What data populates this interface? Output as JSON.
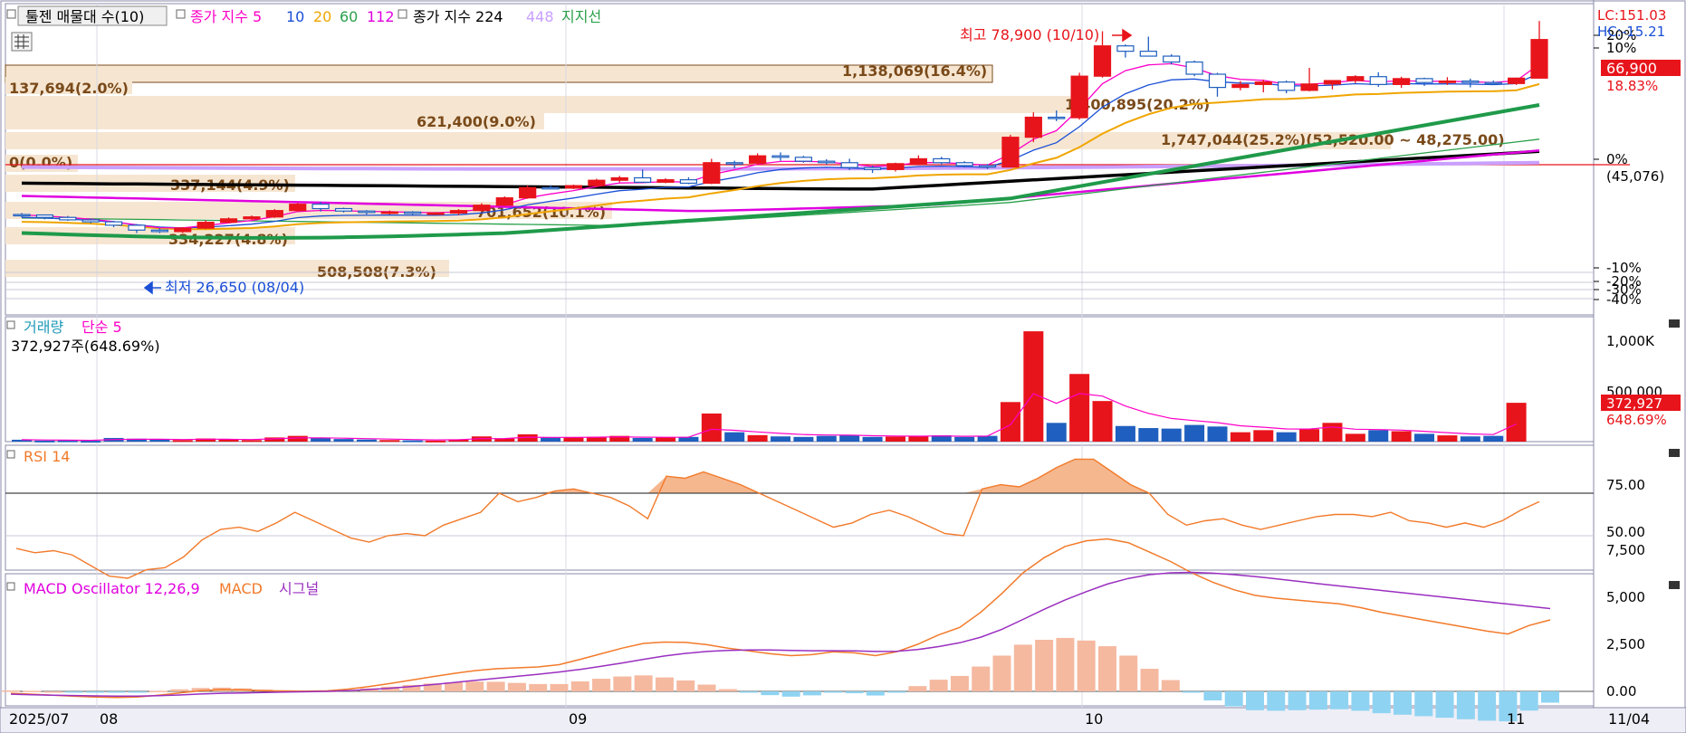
{
  "colors": {
    "up": "#e8141b",
    "down": "#1f5fbf",
    "ma5": "#ff00c8",
    "ma10": "#1a4fd6",
    "ma20": "#f0a500",
    "ma60": "#2aa04a",
    "ma112": "#e000e0",
    "ma224": "#000000",
    "ma448": "#c9a0ff",
    "support": "#1f9a4a",
    "band": "#f6e6d1",
    "bandText": "#7a4a1a",
    "rsi": "#f27a2a",
    "rsiFill": "#f5b78e",
    "macd": "#f27a2a",
    "signal": "#9a2fc0",
    "oscPos": "#f5b9a0",
    "oscNeg": "#8fd3f2",
    "redline": "#e8141b",
    "grid": "#d8d8e4"
  },
  "header": {
    "vp_button": "툴젠 매물대 수(10)",
    "ma_label": "종가 지수 5",
    "ma10": "10",
    "ma20": "20",
    "ma60": "60",
    "ma112": "112",
    "ma_label2": "종가 지수 224",
    "ma448": "448",
    "support": "지지선",
    "lc": "LC:151.03",
    "hc": "HC:-15.21"
  },
  "annotations": {
    "high": "최고 78,900 (10/10)",
    "low": "최저 26,650 (08/04)"
  },
  "right_axis": {
    "price_ticks": [
      "20%",
      "10%",
      "0%",
      "(45,076)",
      "-10%",
      "-20%",
      "-30%",
      "-40%"
    ],
    "current_price": "66,900",
    "current_pct": "18.83%",
    "volume_ticks": [
      "1,000K",
      "500,000"
    ],
    "volume_current": "372,927",
    "volume_pct": "648.69%",
    "rsi_ticks": [
      "75.00",
      "50.00"
    ],
    "macd_ticks": [
      "7,500",
      "5,000",
      "2,500",
      "0.00"
    ],
    "x_end": "11/04"
  },
  "x_labels": [
    "2025/07",
    "08",
    "09",
    "10",
    "11"
  ],
  "panels": {
    "volume_title": "거래량",
    "volume_ma": "단순 5",
    "volume_value": "372,927주(648.69%)",
    "rsi_title": "RSI 14",
    "macd_title": "MACD Oscillator 12,26,9",
    "macd_label": "MACD",
    "signal_label": "시그널"
  },
  "chart_data": {
    "type": "candlestick",
    "date_range": [
      "2025/07",
      "11/04"
    ],
    "volume_profile": [
      {
        "label": "1,138,069(16.4%)"
      },
      {
        "label": "137,694(2.0%)"
      },
      {
        "label": "1,400,895(20.2%)"
      },
      {
        "label": "621,400(9.0%)"
      },
      {
        "label": "1,747,044(25.2%)(52,520.00 ~ 48,275.00)"
      },
      {
        "label": "0(0.0%)"
      },
      {
        "label": "337,144(4.9%)"
      },
      {
        "label": "701,652(10.1%)"
      },
      {
        "label": "334,227(4.8%)"
      },
      {
        "label": "508,508(7.3%)"
      }
    ],
    "volume_profile_pct": [
      16.4,
      2.0,
      20.2,
      9.0,
      25.2,
      0.0,
      4.9,
      10.1,
      4.8,
      7.3
    ],
    "candles_pct": [
      [
        -10.0,
        -9.7,
        -10.6,
        -10.1
      ],
      [
        -10.1,
        -10.0,
        -11.0,
        -10.6
      ],
      [
        -10.6,
        -10.3,
        -11.3,
        -11.1
      ],
      [
        -11.1,
        -10.9,
        -11.8,
        -11.5
      ],
      [
        -11.5,
        -11.3,
        -12.6,
        -12.2
      ],
      [
        -12.2,
        -12.0,
        -13.8,
        -13.2
      ],
      [
        -13.2,
        -12.8,
        -13.8,
        -13.5
      ],
      [
        -13.5,
        -12.6,
        -13.8,
        -12.8
      ],
      [
        -12.8,
        -11.2,
        -13.0,
        -11.6
      ],
      [
        -11.6,
        -10.6,
        -11.8,
        -10.9
      ],
      [
        -10.9,
        -10.2,
        -11.1,
        -10.5
      ],
      [
        -10.5,
        -8.9,
        -10.7,
        -9.2
      ],
      [
        -9.2,
        -7.6,
        -9.4,
        -7.9
      ],
      [
        -7.9,
        -7.4,
        -9.4,
        -8.8
      ],
      [
        -8.8,
        -8.6,
        -9.6,
        -9.3
      ],
      [
        -9.3,
        -9.1,
        -10.0,
        -9.6
      ],
      [
        -9.6,
        -9.2,
        -10.0,
        -9.5
      ],
      [
        -9.5,
        -9.3,
        -10.2,
        -9.8
      ],
      [
        -9.8,
        -9.5,
        -10.1,
        -9.7
      ],
      [
        -9.7,
        -8.9,
        -10.1,
        -9.2
      ],
      [
        -9.2,
        -7.7,
        -9.4,
        -8.1
      ],
      [
        -8.1,
        -6.3,
        -8.3,
        -6.6
      ],
      [
        -6.6,
        -4.1,
        -6.8,
        -4.5
      ],
      [
        -4.5,
        -4.0,
        -4.8,
        -4.6
      ],
      [
        -4.6,
        -3.9,
        -4.8,
        -4.1
      ],
      [
        -4.1,
        -2.7,
        -4.4,
        -3.0
      ],
      [
        -3.0,
        -2.1,
        -3.4,
        -2.5
      ],
      [
        -2.5,
        -0.8,
        -3.5,
        -3.4
      ],
      [
        -3.4,
        -2.6,
        -3.6,
        -2.9
      ],
      [
        -2.9,
        -2.4,
        -3.8,
        -3.6
      ],
      [
        -3.6,
        1.4,
        -3.8,
        0.6
      ],
      [
        0.6,
        1.0,
        -0.6,
        0.5
      ],
      [
        0.5,
        2.5,
        0.2,
        2.0
      ],
      [
        2.0,
        2.7,
        1.0,
        1.7
      ],
      [
        1.7,
        2.0,
        0.6,
        0.9
      ],
      [
        0.9,
        1.3,
        0.2,
        0.6
      ],
      [
        0.6,
        1.4,
        -0.9,
        -0.4
      ],
      [
        -0.4,
        0.0,
        -1.5,
        -0.8
      ],
      [
        -0.8,
        0.6,
        -1.2,
        0.4
      ],
      [
        0.4,
        2.1,
        0.2,
        1.4
      ],
      [
        1.4,
        1.8,
        0.2,
        0.6
      ],
      [
        0.6,
        0.9,
        -0.4,
        0.0
      ],
      [
        0.0,
        0.3,
        -0.7,
        -0.3
      ],
      [
        -0.3,
        6.3,
        -0.4,
        5.8
      ],
      [
        5.8,
        10.9,
        4.8,
        9.9
      ],
      [
        9.9,
        11.3,
        9.1,
        9.8
      ],
      [
        9.8,
        19.0,
        9.4,
        18.3
      ],
      [
        18.3,
        27.5,
        18.0,
        24.5
      ],
      [
        24.5,
        24.8,
        22.1,
        23.4
      ],
      [
        23.4,
        26.4,
        22.7,
        22.4
      ],
      [
        22.4,
        22.8,
        20.7,
        21.2
      ],
      [
        21.2,
        21.5,
        18.3,
        18.7
      ],
      [
        18.7,
        19.0,
        14.1,
        16.0
      ],
      [
        16.0,
        17.3,
        15.4,
        16.6
      ],
      [
        16.6,
        17.6,
        15.0,
        17.1
      ],
      [
        17.1,
        17.4,
        14.8,
        15.4
      ],
      [
        15.4,
        20.0,
        15.2,
        16.7
      ],
      [
        16.7,
        17.5,
        15.6,
        17.4
      ],
      [
        17.4,
        18.5,
        16.9,
        18.2
      ],
      [
        18.2,
        19.1,
        16.1,
        16.6
      ],
      [
        16.6,
        18.2,
        15.9,
        17.8
      ],
      [
        17.8,
        18.0,
        16.3,
        17.0
      ],
      [
        17.0,
        18.1,
        16.5,
        17.3
      ],
      [
        17.3,
        17.8,
        16.0,
        17.0
      ],
      [
        17.0,
        17.4,
        16.5,
        16.8
      ],
      [
        16.8,
        18.0,
        16.5,
        17.9
      ],
      [
        17.9,
        29.6,
        17.8,
        25.8
      ]
    ],
    "volume_k": [
      18,
      10,
      12,
      8,
      35,
      28,
      22,
      15,
      30,
      20,
      15,
      40,
      55,
      38,
      25,
      20,
      15,
      12,
      10,
      22,
      50,
      30,
      70,
      38,
      40,
      45,
      55,
      35,
      40,
      45,
      270,
      90,
      62,
      50,
      45,
      55,
      60,
      45,
      48,
      50,
      60,
      45,
      55,
      380,
      1060,
      180,
      650,
      390,
      150,
      130,
      125,
      160,
      145,
      90,
      110,
      90,
      120,
      180,
      75,
      110,
      100,
      75,
      60,
      50,
      55,
      372.9
    ],
    "rsi": [
      44,
      42,
      43,
      41,
      36,
      31,
      30,
      34,
      35,
      40,
      48,
      53,
      54,
      52,
      56,
      61,
      57,
      53,
      49,
      47,
      50,
      51,
      50,
      55,
      58,
      61,
      70,
      66,
      68,
      71,
      72,
      70,
      68,
      64,
      58,
      78,
      77,
      80,
      77,
      74,
      70,
      66,
      62,
      58,
      54,
      56,
      60,
      62,
      59,
      55,
      51,
      50,
      72,
      74,
      73,
      77,
      82,
      86,
      86,
      80,
      74,
      70,
      60,
      55,
      57,
      58,
      55,
      53,
      55,
      57,
      59,
      60,
      60,
      59,
      61,
      57,
      56,
      54,
      56,
      54,
      57,
      62,
      66
    ],
    "macd": [
      -100,
      -150,
      -200,
      -260,
      -300,
      -320,
      -300,
      -200,
      -80,
      40,
      100,
      80,
      40,
      20,
      10,
      30,
      120,
      260,
      420,
      600,
      780,
      950,
      1100,
      1200,
      1250,
      1300,
      1420,
      1700,
      2000,
      2300,
      2550,
      2620,
      2600,
      2480,
      2300,
      2150,
      2000,
      1900,
      1950,
      2100,
      2050,
      1900,
      2100,
      2500,
      3000,
      3400,
      4200,
      5200,
      6300,
      7100,
      7700,
      8000,
      8100,
      7900,
      7400,
      6900,
      6300,
      5800,
      5400,
      5100,
      4950,
      4850,
      4750,
      4650,
      4450,
      4200,
      4000,
      3800,
      3600,
      3400,
      3200,
      3050,
      3500,
      3800
    ],
    "signal": [
      -150,
      -180,
      -200,
      -220,
      -240,
      -250,
      -250,
      -230,
      -190,
      -140,
      -100,
      -80,
      -60,
      -40,
      -20,
      0,
      40,
      100,
      170,
      260,
      360,
      470,
      580,
      690,
      800,
      910,
      1030,
      1170,
      1330,
      1510,
      1700,
      1880,
      2020,
      2120,
      2180,
      2200,
      2200,
      2180,
      2160,
      2160,
      2150,
      2120,
      2130,
      2220,
      2380,
      2580,
      2880,
      3300,
      3820,
      4360,
      4860,
      5300,
      5700,
      6000,
      6200,
      6300,
      6320,
      6280,
      6200,
      6100,
      5980,
      5850,
      5720,
      5600,
      5480,
      5360,
      5240,
      5120,
      5000,
      4880,
      4760,
      4640,
      4520,
      4400
    ],
    "rsi_levels": [
      70,
      50
    ]
  }
}
